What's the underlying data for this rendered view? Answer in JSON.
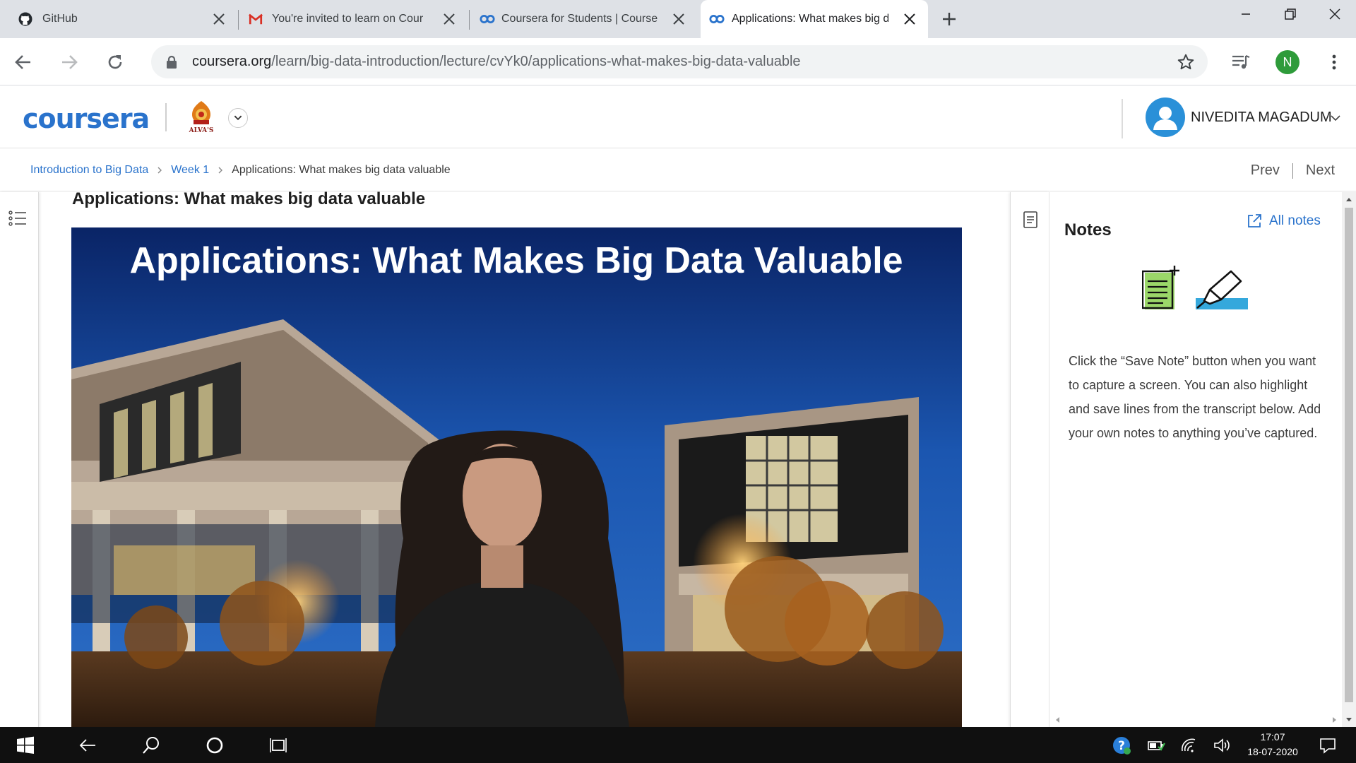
{
  "browser": {
    "tabs": [
      {
        "title": "GitHub",
        "icon": "github-icon"
      },
      {
        "title": "You're invited to learn on Cour",
        "icon": "gmail-icon"
      },
      {
        "title": "Coursera for Students | Course",
        "icon": "coursera-icon"
      },
      {
        "title": "Applications: What makes big d",
        "icon": "coursera-icon",
        "active": true
      }
    ],
    "url_host": "coursera.org",
    "url_path": "/learn/big-data-introduction/lecture/cvYk0/applications-what-makes-big-data-valuable",
    "profile_initial": "N",
    "profile_color": "#2e9b3a"
  },
  "header": {
    "logo": "coursera",
    "org_logo_text": "ALVA'S",
    "user_name": "NIVEDITA MAGADUM"
  },
  "breadcrumb": {
    "course": "Introduction to Big Data",
    "week": "Week 1",
    "current": "Applications: What makes big data valuable",
    "prev": "Prev",
    "next": "Next"
  },
  "lecture": {
    "title": "Applications: What makes big data valuable",
    "video_slide_title": "Applications: What Makes Big Data Valuable"
  },
  "notes": {
    "title": "Notes",
    "all_notes": "All notes",
    "description": "Click the “Save Note” button when you want to capture a screen. You can also highlight and save lines from the transcript below. Add your own notes to anything you’ve captured."
  },
  "taskbar": {
    "time": "17:07",
    "date": "18-07-2020"
  },
  "colors": {
    "coursera_blue": "#2a73cc",
    "link_blue": "#2a73cc",
    "avatar_blue": "#2a90d8",
    "highlighter_blue": "#35a8dc",
    "note_green": "#9bd769"
  }
}
